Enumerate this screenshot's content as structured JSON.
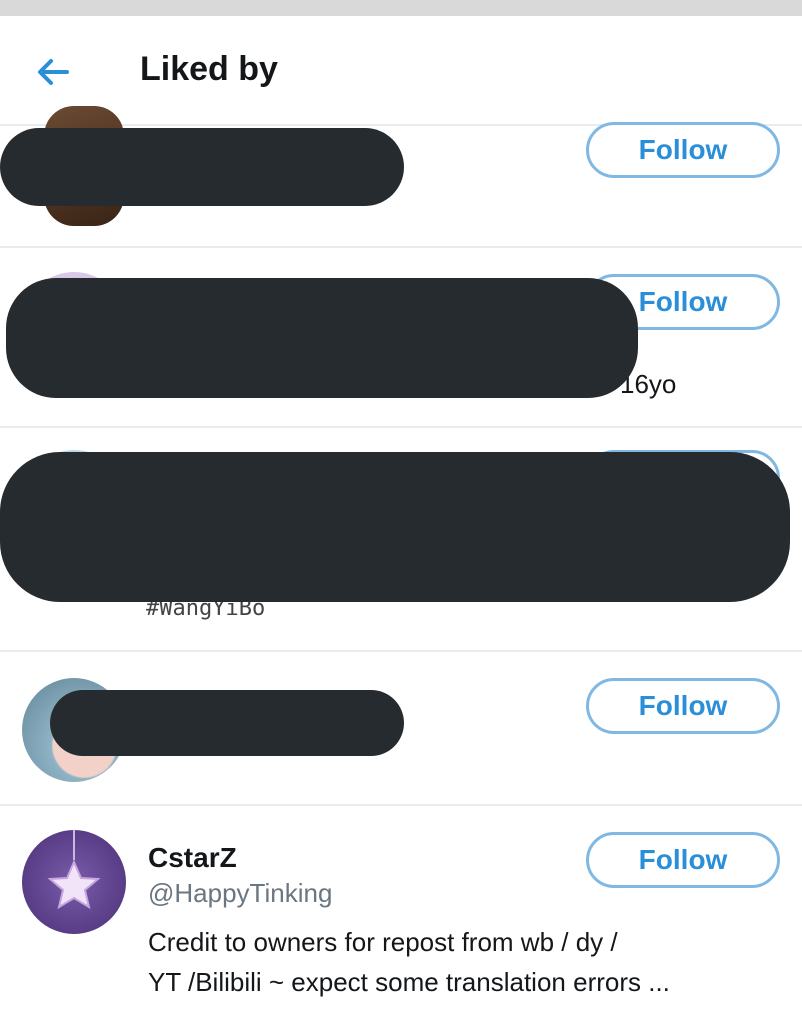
{
  "header": {
    "title": "Liked by",
    "back_icon": "arrow-left-icon"
  },
  "colors": {
    "accent": "#2a8fd8",
    "button_border": "#7fb8e3",
    "redaction": "#262b30",
    "divider": "#e6ecf0"
  },
  "users": [
    {
      "follow_label": "Follow"
    },
    {
      "follow_label": "Follow",
      "bio_fragment": "16yo"
    },
    {
      "bio_fragment": "#WangYiBo"
    },
    {
      "follow_label": "Follow"
    },
    {
      "name": "CstarZ",
      "handle": "@HappyTinking",
      "follow_label": "Follow",
      "bio_line1": "Credit to owners for repost from wb / dy /",
      "bio_line2": "YT /Bilibili ~ expect some translation errors ..."
    }
  ]
}
